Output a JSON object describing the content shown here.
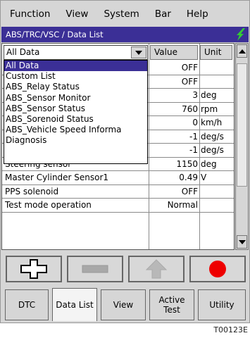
{
  "menu": [
    "Function",
    "View",
    "System",
    "Bar",
    "Help"
  ],
  "title": "ABS/TRC/VSC / Data List",
  "combo": {
    "selected": "All Data"
  },
  "headers": {
    "value": "Value",
    "unit": "Unit"
  },
  "dropdown_options": [
    "All Data",
    "Custom List",
    "ABS_Relay Status",
    "ABS_Sensor Monitor",
    "ABS_Sensor Status",
    "ABS_Sorenoid Status",
    "ABS_Vehicle Speed Informa",
    "Diagnosis"
  ],
  "rows": [
    {
      "name": "",
      "value": "OFF",
      "unit": ""
    },
    {
      "name": "",
      "value": "OFF",
      "unit": ""
    },
    {
      "name": "",
      "value": "3",
      "unit": "deg"
    },
    {
      "name": "",
      "value": "760",
      "unit": "rpm"
    },
    {
      "name": "",
      "value": "0",
      "unit": "km/h"
    },
    {
      "name": "",
      "value": "-1",
      "unit": "deg/s"
    },
    {
      "name": "",
      "value": "-1",
      "unit": "deg/s"
    },
    {
      "name": "Steering sensor",
      "value": "1150",
      "unit": "deg"
    },
    {
      "name": "Master Cylinder Sensor1",
      "value": "0.49",
      "unit": "V"
    },
    {
      "name": "PPS solenoid",
      "value": "OFF",
      "unit": ""
    },
    {
      "name": "Test mode operation",
      "value": "Normal",
      "unit": ""
    }
  ],
  "tabs": [
    "DTC",
    "Data List",
    "View",
    "Active Test",
    "Utility"
  ],
  "active_tab": "Data List",
  "caption": "T00123E",
  "colors": {
    "title_bg": "#3b2f96",
    "record_dot": "#ee0000",
    "plug_icon": "#33cc33"
  }
}
